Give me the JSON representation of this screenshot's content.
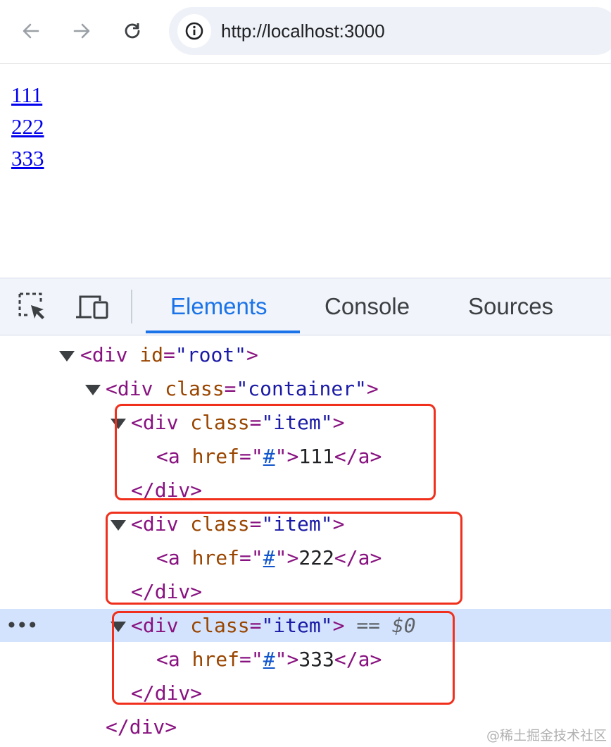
{
  "browser": {
    "url": "http://localhost:3000"
  },
  "page": {
    "links": [
      "111",
      "222",
      "333"
    ]
  },
  "devtools": {
    "tabs": [
      "Elements",
      "Console",
      "Sources"
    ],
    "active_tab": "Elements",
    "tree": {
      "root_open": "<div",
      "root_attr": "id",
      "root_val": "\"root\"",
      "container_attr": "class",
      "container_val": "\"container\"",
      "item_attr": "class",
      "item_val": "\"item\"",
      "href_attr": "href",
      "href_val": "#",
      "items": [
        "111",
        "222",
        "333"
      ],
      "selected_marker": "== $0",
      "close_div": "</div>"
    }
  },
  "watermark": "@稀土掘金技术社区",
  "colors": {
    "highlight_box": "#f0301c",
    "selected_row": "#d3e3fd",
    "active_tab": "#1a73e8"
  }
}
